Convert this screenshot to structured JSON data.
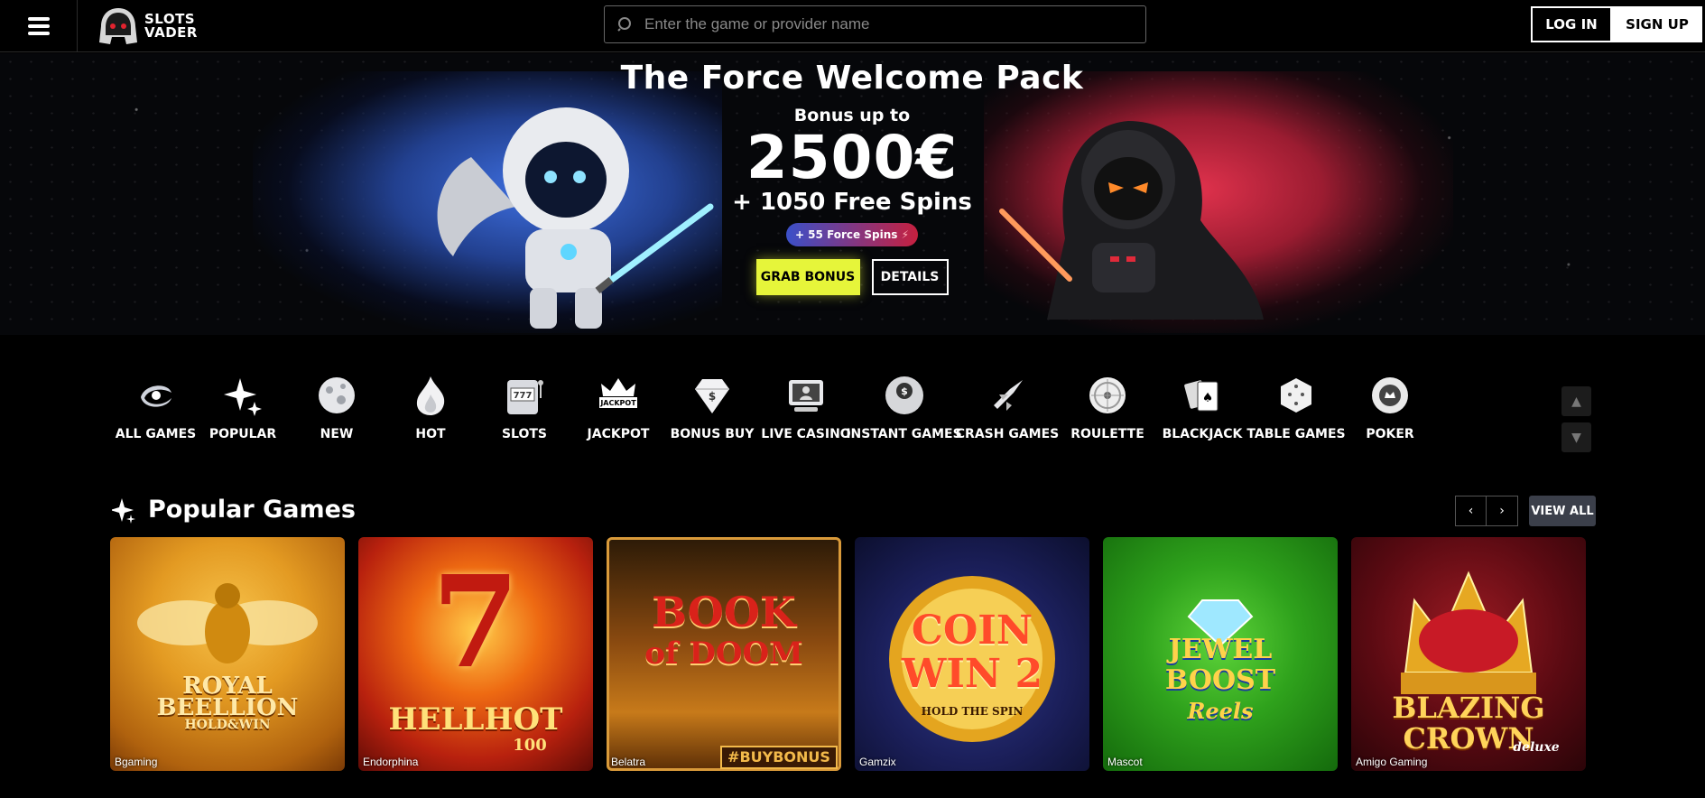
{
  "header": {
    "logo_line1": "SLOTS",
    "logo_line2": "VADER",
    "search_placeholder": "Enter the game or provider name",
    "login_label": "LOG IN",
    "signup_label": "SIGN UP"
  },
  "hero": {
    "title": "The Force Welcome Pack",
    "subtitle": "Bonus up to",
    "amount": "2500€",
    "spins": "+ 1050 Free Spins",
    "force_spins": "+ 55 Force Spins",
    "grab_label": "GRAB BONUS",
    "details_label": "DETAILS",
    "colors": {
      "left_glow": "#3e6fe0",
      "right_glow": "#e1324d",
      "grab_bg": "#e6f53a"
    }
  },
  "categories": [
    {
      "label": "ALL GAMES",
      "icon": "galaxy-icon"
    },
    {
      "label": "POPULAR",
      "icon": "sparkle-icon"
    },
    {
      "label": "NEW",
      "icon": "planet-icon"
    },
    {
      "label": "HOT",
      "icon": "flame-icon"
    },
    {
      "label": "SLOTS",
      "icon": "slot-machine-icon"
    },
    {
      "label": "JACKPOT",
      "icon": "jackpot-crown-icon"
    },
    {
      "label": "BONUS BUY",
      "icon": "diamond-icon"
    },
    {
      "label": "LIVE CASINO",
      "icon": "live-dealer-icon"
    },
    {
      "label": "INSTANT GAMES",
      "icon": "eight-ball-icon"
    },
    {
      "label": "CRASH GAMES",
      "icon": "spaceship-icon"
    },
    {
      "label": "ROULETTE",
      "icon": "roulette-icon"
    },
    {
      "label": "BLACKJACK",
      "icon": "cards-icon"
    },
    {
      "label": "TABLE GAMES",
      "icon": "dice-icon"
    },
    {
      "label": "POKER",
      "icon": "poker-chip-icon"
    }
  ],
  "popular": {
    "title": "Popular Games",
    "view_all_label": "VIEW ALL",
    "games": [
      {
        "provider": "Bgaming",
        "art_line1": "ROYAL",
        "art_line2": "BEELLION",
        "art_line3": "HOLD&WIN"
      },
      {
        "provider": "Endorphina",
        "art_line1": "7",
        "art_line2": "HELLHOT",
        "art_line3": "100"
      },
      {
        "provider": "Belatra",
        "art_line1": "BOOK",
        "art_line2": "of DOOM",
        "art_line3": "#BUYBONUS"
      },
      {
        "provider": "Gamzix",
        "art_line1": "COIN",
        "art_line2": "WIN 2",
        "art_line3": "HOLD THE SPIN"
      },
      {
        "provider": "Mascot",
        "art_line1": "JEWEL",
        "art_line2": "BOOST",
        "art_line3": "Reels"
      },
      {
        "provider": "Amigo Gaming",
        "art_line1": "BLAZING",
        "art_line2": "CROWN",
        "art_line3": "deluxe"
      }
    ]
  }
}
